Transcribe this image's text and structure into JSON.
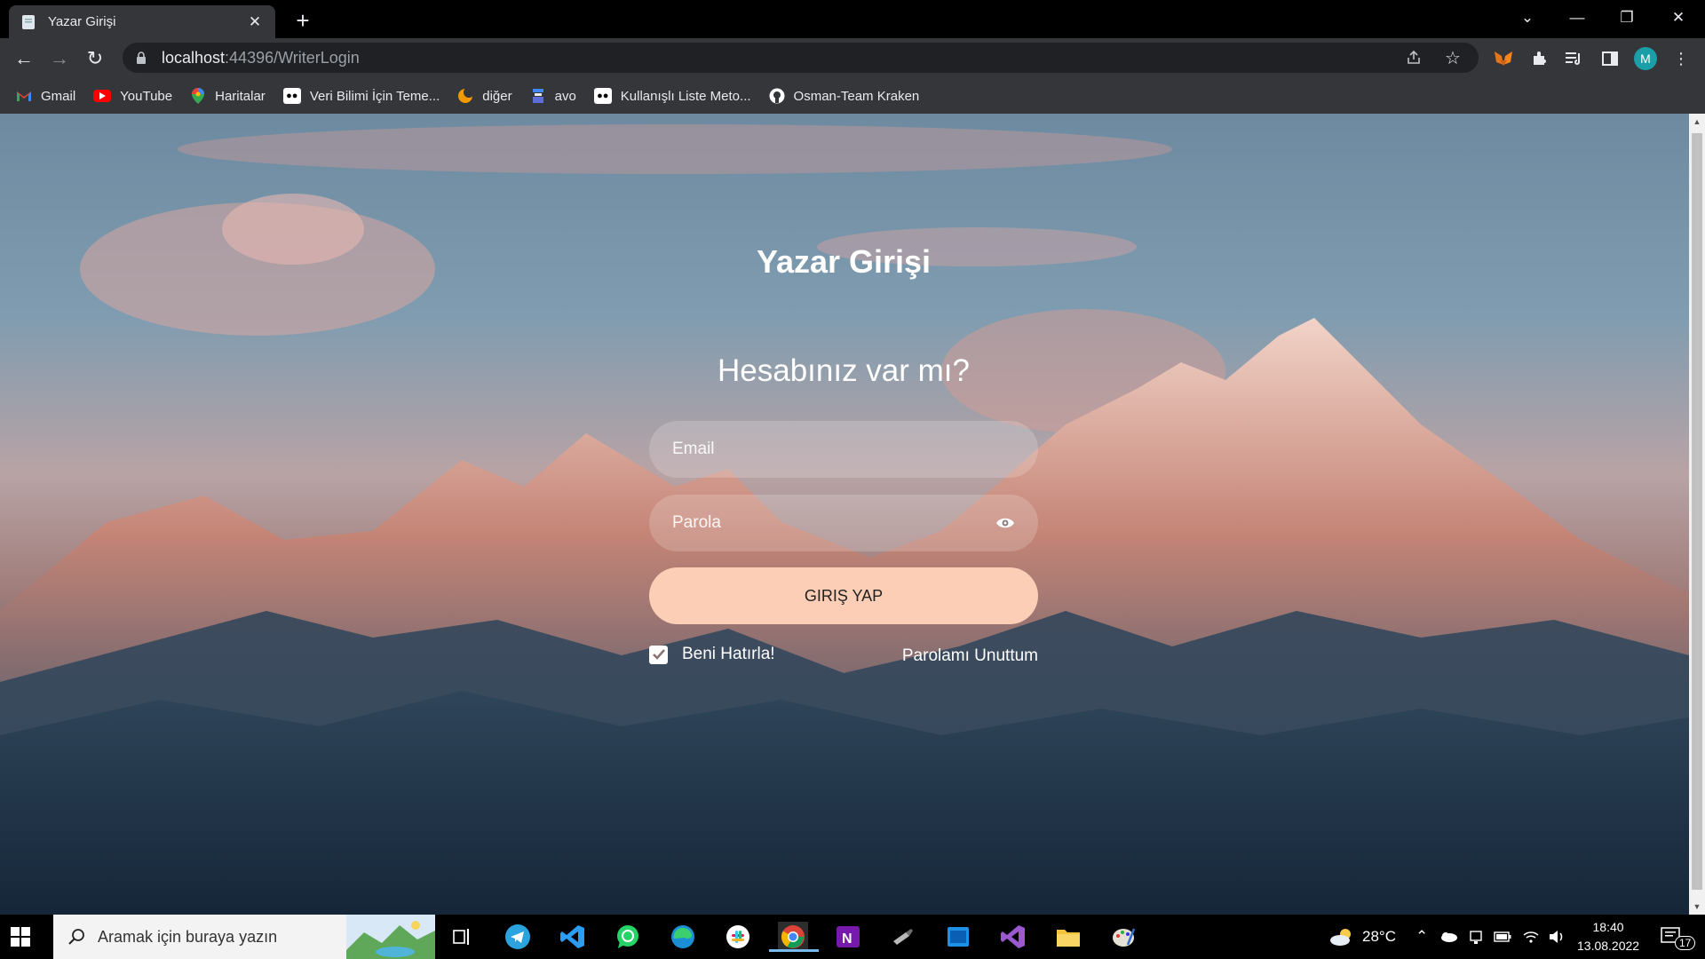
{
  "browser": {
    "tab_title": "Yazar Girişi",
    "url_host": "localhost",
    "url_path": ":44396/WriterLogin",
    "profile_initial": "M",
    "bookmarks": [
      {
        "label": "Gmail",
        "icon": "gmail-icon"
      },
      {
        "label": "YouTube",
        "icon": "youtube-icon"
      },
      {
        "label": "Haritalar",
        "icon": "maps-icon"
      },
      {
        "label": "Veri Bilimi İçin Teme...",
        "icon": "medium-icon"
      },
      {
        "label": "diğer",
        "icon": "moon-icon"
      },
      {
        "label": "avo",
        "icon": "avo-icon"
      },
      {
        "label": "Kullanışlı Liste Meto...",
        "icon": "medium-icon"
      },
      {
        "label": "Osman-Team Kraken",
        "icon": "github-icon"
      }
    ]
  },
  "login": {
    "title": "Yazar Girişi",
    "subtitle": "Hesabınız var mı?",
    "email_placeholder": "Email",
    "password_placeholder": "Parola",
    "submit_label": "GIRIŞ YAP",
    "remember_label": "Beni Hatırla!",
    "remember_checked": true,
    "forgot_label": "Parolamı Unuttum"
  },
  "taskbar": {
    "search_placeholder": "Aramak için buraya yazın",
    "weather": "28°C",
    "time": "18:40",
    "date": "13.08.2022",
    "notification_count": "17"
  },
  "colors": {
    "button_bg": "#fbceb5",
    "browser_frame": "#35363a",
    "tab_strip": "#000000"
  }
}
